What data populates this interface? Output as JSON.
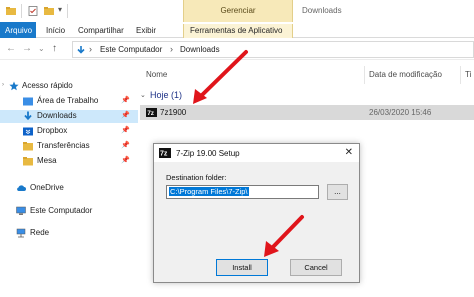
{
  "title_bar": {
    "context_group": "Gerenciar",
    "window_title": "Downloads"
  },
  "ribbon": {
    "tabs": [
      "Arquivo",
      "Início",
      "Compartilhar",
      "Exibir",
      "Ferramentas de Aplicativo"
    ]
  },
  "address": {
    "crumbs": [
      "Este Computador",
      "Downloads"
    ]
  },
  "nav_pane": {
    "items": [
      {
        "label": "Acesso rápido",
        "icon": "star-icon"
      },
      {
        "label": "Área de Trabalho",
        "icon": "desktop-folder-icon"
      },
      {
        "label": "Downloads",
        "icon": "download-folder-icon"
      },
      {
        "label": "Dropbox",
        "icon": "dropbox-icon"
      },
      {
        "label": "Transferências",
        "icon": "folder-icon"
      },
      {
        "label": "Mesa",
        "icon": "folder-icon"
      },
      {
        "label": "OneDrive",
        "icon": "cloud-icon"
      },
      {
        "label": "Este Computador",
        "icon": "computer-icon"
      },
      {
        "label": "Rede",
        "icon": "network-icon"
      }
    ],
    "selected": "Downloads"
  },
  "file_list": {
    "columns": [
      "Nome",
      "Data de modificação",
      "Ti"
    ],
    "group": "Hoje (1)",
    "rows": [
      {
        "name": "7z1900",
        "date": "26/03/2020 15:46"
      }
    ]
  },
  "dialog": {
    "icon_text": "7z",
    "title": "7-Zip 19.00 Setup",
    "close": "✕",
    "dest_label": "Destination folder:",
    "dest_value": "C:\\Program Files\\7-Zip\\",
    "browse": "...",
    "install": "Install",
    "cancel": "Cancel"
  },
  "colors": {
    "accent": "#1979ca",
    "context_tab": "#f7e9b9",
    "arrow": "#e0151b",
    "selection": "#cde8fb"
  }
}
